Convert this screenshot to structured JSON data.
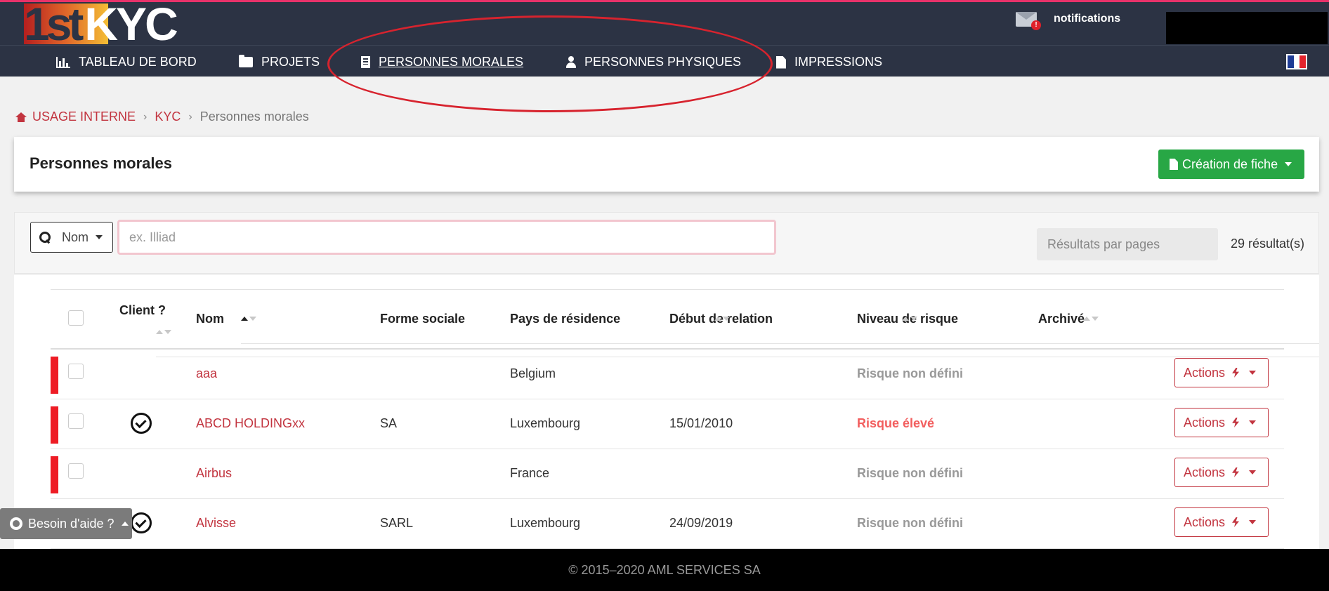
{
  "header": {
    "logo_one": "1st",
    "logo_kyc": "KYC",
    "notifications_label": "notifications",
    "notification_badge": "!"
  },
  "nav": {
    "items": [
      {
        "label": "TABLEAU DE BORD",
        "icon": "bar-chart-icon"
      },
      {
        "label": "PROJETS",
        "icon": "folder-open-icon"
      },
      {
        "label": "PERSONNES MORALES",
        "icon": "building-icon",
        "active": true
      },
      {
        "label": "PERSONNES PHYSIQUES",
        "icon": "user-icon"
      },
      {
        "label": "IMPRESSIONS",
        "icon": "file-icon"
      }
    ],
    "language_flag": "french-flag-icon"
  },
  "breadcrumb": {
    "items": [
      "USAGE INTERNE",
      "KYC",
      "Personnes morales"
    ],
    "separator": "›"
  },
  "page": {
    "title": "Personnes morales",
    "create_button": "Création de fiche"
  },
  "filters": {
    "search_type": "Nom",
    "search_placeholder": "ex. Illiad",
    "search_value": "",
    "per_page_label": "Résultats par pages",
    "results_count": "29 résultat(s)"
  },
  "table": {
    "columns": [
      "Client ?",
      "Nom",
      "Forme sociale",
      "Pays de résidence",
      "Début de relation",
      "Niveau de risque",
      "Archivé"
    ],
    "rows": [
      {
        "client": false,
        "nom": "aaa",
        "forme": "",
        "pays": "Belgium",
        "debut": "",
        "risque": "Risque non défini",
        "risk_level": "undefined",
        "flag": true,
        "action": "Actions"
      },
      {
        "client": true,
        "nom": "ABCD HOLDINGxx",
        "forme": "SA",
        "pays": "Luxembourg",
        "debut": "15/01/2010",
        "risque": "Risque élevé",
        "risk_level": "high",
        "flag": true,
        "action": "Actions"
      },
      {
        "client": false,
        "nom": "Airbus",
        "forme": "",
        "pays": "France",
        "debut": "",
        "risque": "Risque non défini",
        "risk_level": "undefined",
        "flag": true,
        "action": "Actions"
      },
      {
        "client": true,
        "nom": "Alvisse",
        "forme": "SARL",
        "pays": "Luxembourg",
        "debut": "24/09/2019",
        "risque": "Risque non défini",
        "risk_level": "undefined",
        "flag": false,
        "action": "Actions"
      }
    ]
  },
  "help": {
    "label": "Besoin d'aide ?"
  },
  "footer": {
    "copyright": "© 2015–2020 AML SERVICES SA"
  },
  "colors": {
    "header_bg": "#2c3344",
    "accent_red": "#c2343f",
    "flag_red": "#ee1c25",
    "create_green": "#28a745",
    "risk_high": "#f25e5e",
    "annotation_ellipse": "#d7232e"
  }
}
